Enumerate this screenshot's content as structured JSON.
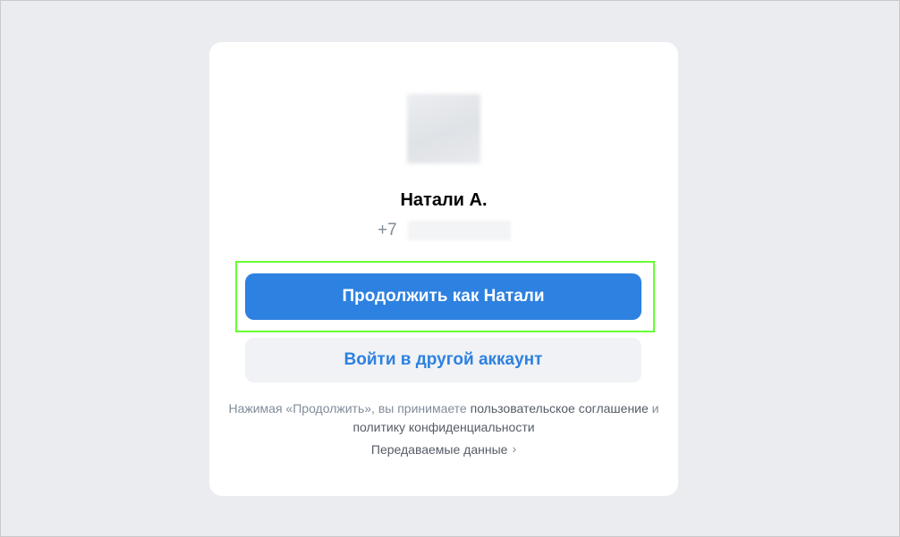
{
  "user": {
    "name": "Натали А.",
    "phone_prefix": "+7"
  },
  "actions": {
    "continue_label": "Продолжить как Натали",
    "other_account_label": "Войти в другой аккаунт"
  },
  "terms": {
    "text_before": "Нажимая «Продолжить», вы принимаете ",
    "user_agreement_link": "пользовательское соглашение",
    "text_and": " и ",
    "privacy_link": "политику конфиденциальности"
  },
  "transfer": {
    "label": "Передаваемые данные",
    "chevron_icon": "chevron-right-icon"
  },
  "colors": {
    "primary": "#2d81e0",
    "background": "#ebecef",
    "highlight": "#66ff33"
  }
}
